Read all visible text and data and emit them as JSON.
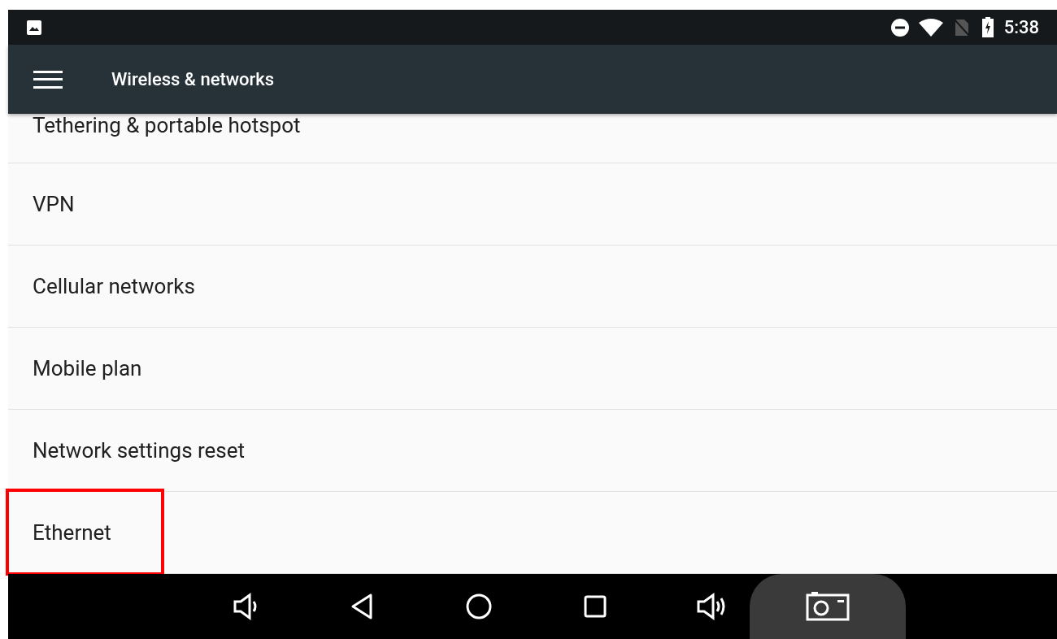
{
  "status_bar": {
    "time": "5:38"
  },
  "toolbar": {
    "title": "Wireless & networks"
  },
  "items": [
    {
      "label": "Tethering & portable hotspot",
      "highlighted": false
    },
    {
      "label": "VPN",
      "highlighted": false
    },
    {
      "label": "Cellular networks",
      "highlighted": false
    },
    {
      "label": "Mobile plan",
      "highlighted": false
    },
    {
      "label": "Network settings reset",
      "highlighted": false
    },
    {
      "label": "Ethernet",
      "highlighted": true
    }
  ]
}
